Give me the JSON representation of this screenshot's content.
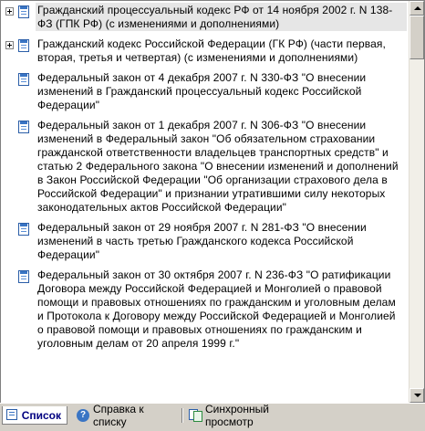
{
  "list": {
    "items": [
      {
        "expandable": true,
        "selected": true,
        "text": "Гражданский процессуальный кодекс РФ от 14 ноября 2002 г. N 138-ФЗ (ГПК РФ) (с изменениями и дополнениями)"
      },
      {
        "expandable": true,
        "selected": false,
        "text": "Гражданский кодекс Российской Федерации (ГК РФ) (части первая, вторая, третья и четвертая) (с изменениями и дополнениями)"
      },
      {
        "expandable": false,
        "selected": false,
        "text": "Федеральный закон от 4 декабря 2007 г. N 330-ФЗ \"О внесении изменений в Гражданский процессуальный кодекс Российской Федерации\""
      },
      {
        "expandable": false,
        "selected": false,
        "text": "Федеральный закон от 1 декабря 2007 г. N 306-ФЗ \"О внесении изменений в Федеральный закон \"Об обязательном страховании гражданской ответственности владельцев транспортных средств\" и статью 2 Федерального закона \"О внесении изменений и дополнений в Закон Российской Федерации \"Об организации страхового дела в Российской Федерации\" и признании утратившими силу некоторых законодательных актов Российской Федерации\""
      },
      {
        "expandable": false,
        "selected": false,
        "text": "Федеральный закон от 29 ноября 2007 г. N 281-ФЗ \"О внесении изменений в часть третью Гражданского кодекса Российской Федерации\""
      },
      {
        "expandable": false,
        "selected": false,
        "text": "Федеральный закон от 30 октября 2007 г. N 236-ФЗ \"О ратификации Договора между Российской Федерацией и Монголией о правовой помощи и правовых отношениях по гражданским и уголовным делам и Протокола к Договору между Российской Федерацией и Монголией о правовой помощи и правовых отношениях по гражданским и уголовным делам от 20 апреля 1999 г.\""
      }
    ]
  },
  "tabs": {
    "list_label": "Список",
    "help_label": "Справка к списку",
    "sync_label": "Синхронный просмотр"
  }
}
